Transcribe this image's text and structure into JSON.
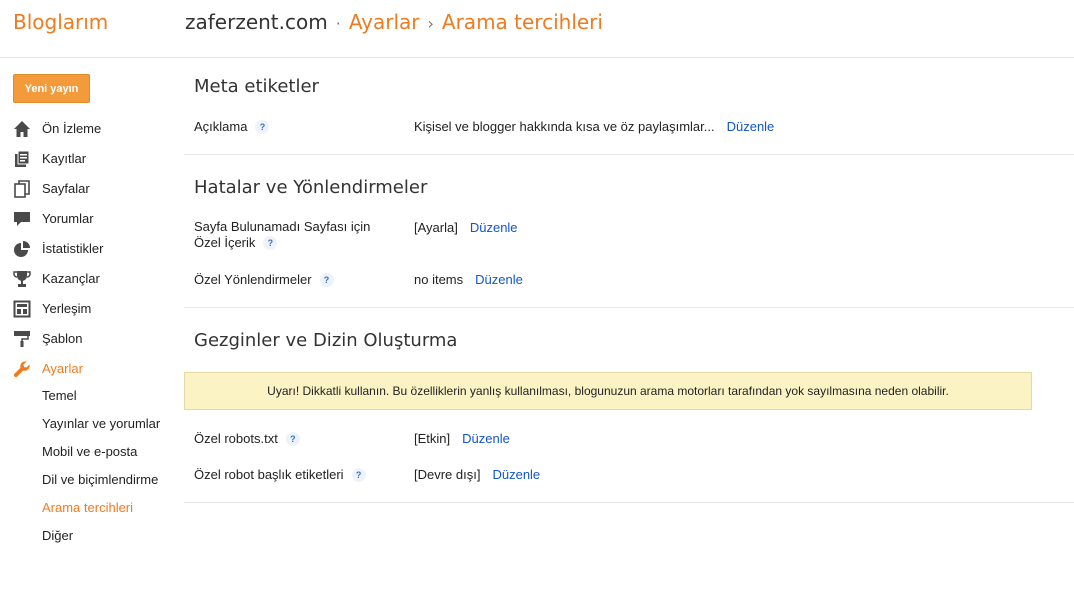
{
  "header": {
    "logo": "Bloglarım",
    "breadcrumb": {
      "site": "zaferzent.com",
      "sep1": "·",
      "section": "Ayarlar",
      "sep2": "›",
      "page": "Arama tercihleri"
    }
  },
  "sidebar": {
    "new_post_label": "Yeni yayın",
    "items": [
      {
        "label": "Ön İzleme",
        "icon": "home-icon"
      },
      {
        "label": "Kayıtlar",
        "icon": "posts-icon"
      },
      {
        "label": "Sayfalar",
        "icon": "pages-icon"
      },
      {
        "label": "Yorumlar",
        "icon": "comments-icon"
      },
      {
        "label": "İstatistikler",
        "icon": "stats-icon"
      },
      {
        "label": "Kazançlar",
        "icon": "trophy-icon"
      },
      {
        "label": "Yerleşim",
        "icon": "layout-icon"
      },
      {
        "label": "Şablon",
        "icon": "paint-roller-icon"
      },
      {
        "label": "Ayarlar",
        "icon": "wrench-icon"
      }
    ],
    "sub_items": [
      {
        "label": "Temel"
      },
      {
        "label": "Yayınlar ve yorumlar"
      },
      {
        "label": "Mobil ve e-posta"
      },
      {
        "label": "Dil ve biçimlendirme"
      },
      {
        "label": "Arama tercihleri"
      },
      {
        "label": "Diğer"
      }
    ]
  },
  "main": {
    "meta": {
      "title": "Meta etiketler",
      "description_label": "Açıklama",
      "description_value": "Kişisel ve blogger hakkında kısa ve öz paylaşımlar...",
      "edit_label": "Düzenle"
    },
    "errors": {
      "title": "Hatalar ve Yönlendirmeler",
      "notfound_label_line1": "Sayfa Bulunamadı Sayfası için",
      "notfound_label_line2": "Özel İçerik",
      "notfound_value": "[Ayarla]",
      "redirects_label": "Özel Yönlendirmeler",
      "redirects_value": "no items",
      "edit_label": "Düzenle"
    },
    "crawlers": {
      "title": "Gezginler ve Dizin Oluşturma",
      "warning": "Uyarı! Dikkatli kullanın. Bu özelliklerin yanlış kullanılması, blogunuzun arama motorları tarafından yok sayılmasına neden olabilir.",
      "robots_label": "Özel robots.txt",
      "robots_value": "[Etkin]",
      "robot_headers_label": "Özel robot başlık etiketleri",
      "robot_headers_value": "[Devre dışı]",
      "edit_label": "Düzenle"
    },
    "help_glyph": "?"
  },
  "colors": {
    "accent": "#f07b1f",
    "link": "#1155cc",
    "warning_bg": "#fcf3c5",
    "button_bg": "#f39b3b"
  }
}
